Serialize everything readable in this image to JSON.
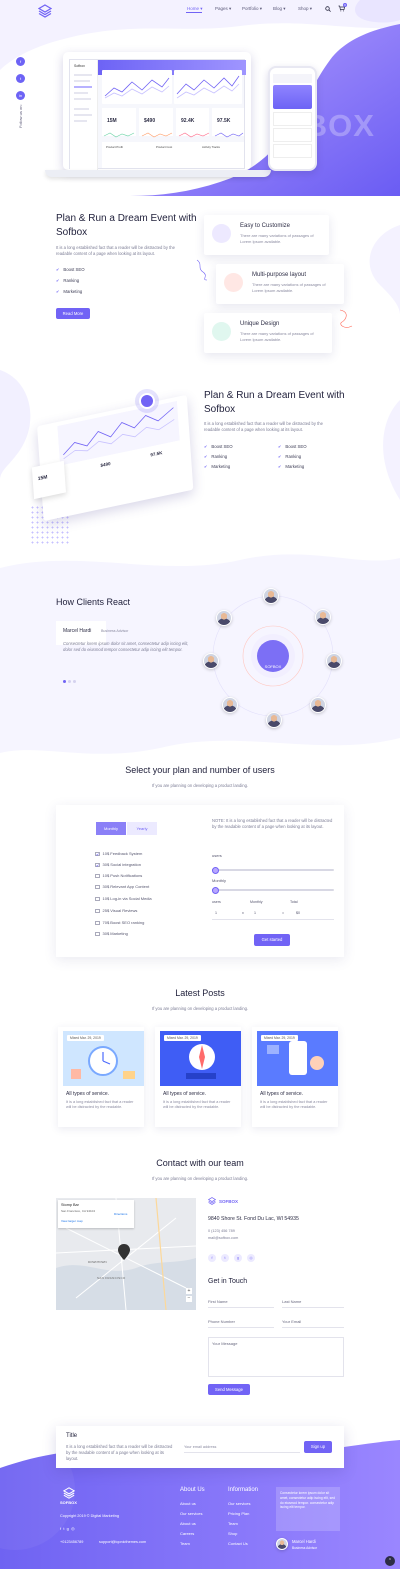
{
  "nav": {
    "items": [
      "Home ▾",
      "Pages ▾",
      "Portfolio ▾",
      "Blog ▾",
      "Shop ▾"
    ],
    "cart_count": "0",
    "follow_text": "Follow us on:",
    "social": [
      "f",
      "t",
      "in"
    ]
  },
  "hero": {
    "watermark": "SOFBOX",
    "dashboard": {
      "brand": "Sofbox",
      "stats": [
        "15M",
        "$490",
        "92.4K",
        "97.5K"
      ],
      "footer_labels": [
        "Product Profit",
        "Product Cost",
        "Activity Tracks"
      ]
    }
  },
  "intro": {
    "title": "Plan & Run a Dream Event with Sofbox",
    "text": "It is a long established fact that a reader will be distracted by the readable content of a page when looking at its layout.",
    "checks": [
      "Boost SEO",
      "Ranking",
      "Marketing"
    ],
    "button": "Read More",
    "features": [
      {
        "title": "Easy to Customize",
        "text": "There are many variations of passages of Lorem Ipsum available."
      },
      {
        "title": "Multi-purpose layout",
        "text": "There are many variations of passages of Lorem Ipsum available."
      },
      {
        "title": "Unique Design",
        "text": "There are many variations of passages of Lorem Ipsum available."
      }
    ]
  },
  "about": {
    "title": "Plan & Run a Dream Event with Sofbox",
    "text": "It is a long established fact that a reader will be distracted by the readable content of a page when looking at its layout.",
    "checks_left": [
      "Boost SEO",
      "Ranking",
      "Marketing"
    ],
    "checks_right": [
      "Boost SEO",
      "Ranking",
      "Marketing"
    ],
    "mockup_stats": [
      "15M",
      "$490",
      "97.5K"
    ]
  },
  "clients": {
    "title": "How Clients React",
    "name": "Marcel Hardi",
    "role": "Business Advisor",
    "quote": "Consectetur lorem ipsum dolor sit amet, consectetur adip iscing elit, dolor sed do eiusmod tempor consectetur adip iscing elit tempor.",
    "center_label": "SOFBOX"
  },
  "pricing": {
    "title": "Select your plan and number of users",
    "subtitle": "If you are planning on developing a product landing.",
    "toggle": [
      "Monthly",
      "Yearly"
    ],
    "options": [
      {
        "label": "10$ Feedback System",
        "checked": true
      },
      {
        "label": "30$ Social integration",
        "checked": true
      },
      {
        "label": "10$ Push Notifications",
        "checked": false
      },
      {
        "label": "30$ Relevant App Content",
        "checked": false
      },
      {
        "label": "10$ Log-in via Social Media",
        "checked": false
      },
      {
        "label": "25$ Visual Reviews",
        "checked": false
      },
      {
        "label": "70$ Boost SEO ranking",
        "checked": false
      },
      {
        "label": "30$ Marketing",
        "checked": false
      }
    ],
    "note": "NOTE: It is a long established fact that a reader will be distracted by the readable content of a page when looking at its layout.",
    "users_label": "users",
    "monthly_label": "Monthly",
    "calc": {
      "users": "1",
      "op1": "x",
      "monthly": "1",
      "op2": "=",
      "total": "$0",
      "h_users": "users",
      "h_monthly": "Monthly",
      "h_total": "Total"
    },
    "button": "Get started"
  },
  "posts": {
    "title": "Latest Posts",
    "subtitle": "If you are planning on developing a product landing.",
    "items": [
      {
        "date": "Mixed Mar. 29, 2019",
        "title": "All types of service.",
        "text": "It is a long established fact that a reader will be distracted by the readable."
      },
      {
        "date": "Mixed Mar. 29, 2019",
        "title": "All types of service.",
        "text": "It is a long established fact that a reader will be distracted by the readable."
      },
      {
        "date": "Mixed Mar. 29, 2019",
        "title": "All types of service.",
        "text": "It is a long established fact that a reader will be distracted by the readable."
      }
    ]
  },
  "contact": {
    "title": "Contact with our team",
    "subtitle": "If you are planning on developing a product landing.",
    "map_card": {
      "name": "Stomp Bar",
      "address": "San Francisco, CA 94104",
      "link": "View larger map",
      "directions": "Directions"
    },
    "brand": "SOFBOX",
    "address": "9840 Shore St. Fond Du Lac, WI 54935",
    "phone": "0 (123) 456 789",
    "email": "mail@sofbox.com",
    "get_in_touch": "Get in Touch",
    "fields": {
      "first": "First Name",
      "last": "Last Name",
      "phone": "Phone Number",
      "email": "Your Email",
      "message": "Your Message"
    },
    "button": "Send Message",
    "map_labels": [
      "SAN FRANCISCO",
      "DOWNTOWN"
    ]
  },
  "newsletter": {
    "title": "Title",
    "text": "It is a long established fact that a reader will be distracted by the readable content of a page when looking at its layout.",
    "placeholder": "Your email address",
    "button": "Sign up"
  },
  "footer": {
    "brand": "SOFBOX",
    "copyright": "Copyright 2019 © Digital Marketing",
    "phone": "+0123456789",
    "email": "support@iqonicthemes.com",
    "about_title": "About Us",
    "about_links": [
      "About us",
      "Our services",
      "About us",
      "Careers",
      "Team"
    ],
    "info_title": "Information",
    "info_links": [
      "Our services",
      "Pricing Plan",
      "Team",
      "Shop",
      "Contact Us"
    ],
    "testimonial": "Consectetur lorem ipsum dolor sit amet, consectetur adip iscing elit, sed do eiusmod tempor. consectetur adip iscing elit tempor.",
    "testimonial_name": "Marcel Hardi",
    "testimonial_role": "Business Advisor"
  },
  "colors": {
    "accent": "#7163f5",
    "accent_light": "#a49cff",
    "text_dark": "#1f1f3a"
  }
}
